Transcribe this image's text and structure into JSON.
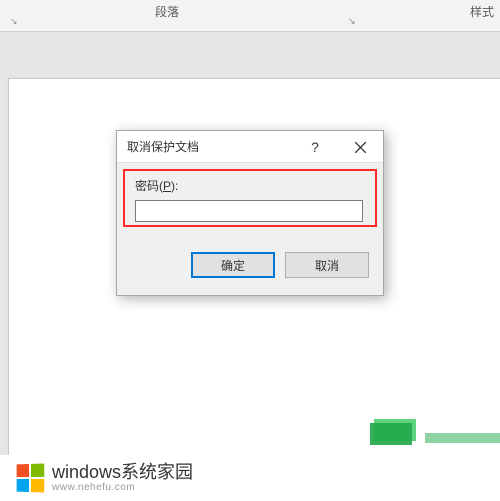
{
  "ribbon": {
    "paragraph_label": "段落",
    "styles_label": "样式"
  },
  "dialog": {
    "title": "取消保护文档",
    "help_symbol": "?",
    "password_label_prefix": "密码(",
    "password_label_accel": "P",
    "password_label_suffix": "):",
    "password_value": "",
    "ok_label": "确定",
    "cancel_label": "取消"
  },
  "watermark": {
    "brand": "windows系统家园",
    "url": "www.nehefu.com"
  }
}
